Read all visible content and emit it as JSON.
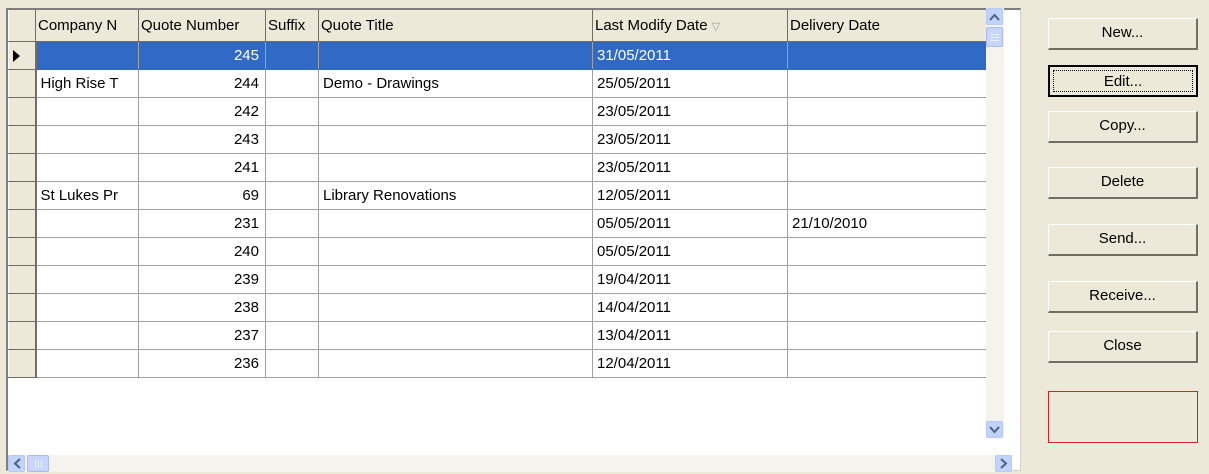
{
  "columns": {
    "company": "Company N",
    "quote_number": "Quote Number",
    "suffix": "Suffix",
    "quote_title": "Quote Title",
    "last_modify_date": "Last Modify Date",
    "delivery_date": "Delivery Date"
  },
  "sort_indicator": "▽",
  "rows": [
    {
      "company": "",
      "quote_number": "245",
      "suffix": "",
      "quote_title": "",
      "last_modify_date": "31/05/2011",
      "delivery_date": ""
    },
    {
      "company": "High Rise T",
      "quote_number": "244",
      "suffix": "",
      "quote_title": "Demo - Drawings",
      "last_modify_date": "25/05/2011",
      "delivery_date": ""
    },
    {
      "company": "",
      "quote_number": "242",
      "suffix": "",
      "quote_title": "",
      "last_modify_date": "23/05/2011",
      "delivery_date": ""
    },
    {
      "company": "",
      "quote_number": "243",
      "suffix": "",
      "quote_title": "",
      "last_modify_date": "23/05/2011",
      "delivery_date": ""
    },
    {
      "company": "",
      "quote_number": "241",
      "suffix": "",
      "quote_title": "",
      "last_modify_date": "23/05/2011",
      "delivery_date": ""
    },
    {
      "company": "St Lukes Pr",
      "quote_number": "69",
      "suffix": "",
      "quote_title": "Library Renovations",
      "last_modify_date": "12/05/2011",
      "delivery_date": ""
    },
    {
      "company": "",
      "quote_number": "231",
      "suffix": "",
      "quote_title": "",
      "last_modify_date": "05/05/2011",
      "delivery_date": "21/10/2010"
    },
    {
      "company": "",
      "quote_number": "240",
      "suffix": "",
      "quote_title": "",
      "last_modify_date": "05/05/2011",
      "delivery_date": ""
    },
    {
      "company": "",
      "quote_number": "239",
      "suffix": "",
      "quote_title": "",
      "last_modify_date": "19/04/2011",
      "delivery_date": ""
    },
    {
      "company": "",
      "quote_number": "238",
      "suffix": "",
      "quote_title": "",
      "last_modify_date": "14/04/2011",
      "delivery_date": ""
    },
    {
      "company": "",
      "quote_number": "237",
      "suffix": "",
      "quote_title": "",
      "last_modify_date": "13/04/2011",
      "delivery_date": ""
    },
    {
      "company": "",
      "quote_number": "236",
      "suffix": "",
      "quote_title": "",
      "last_modify_date": "12/04/2011",
      "delivery_date": ""
    }
  ],
  "selected_row": 0,
  "buttons": {
    "new": "New...",
    "edit": "Edit...",
    "copy": "Copy...",
    "delete": "Delete",
    "send": "Send...",
    "receive": "Receive...",
    "close": "Close"
  },
  "scrollbar_icons": {
    "up": "up-arrow-icon",
    "down": "down-arrow-icon",
    "left": "left-arrow-icon",
    "right": "right-arrow-icon"
  },
  "colors": {
    "selection": "#316ac5",
    "window": "#ece9d8",
    "status_border": "#e02020"
  }
}
